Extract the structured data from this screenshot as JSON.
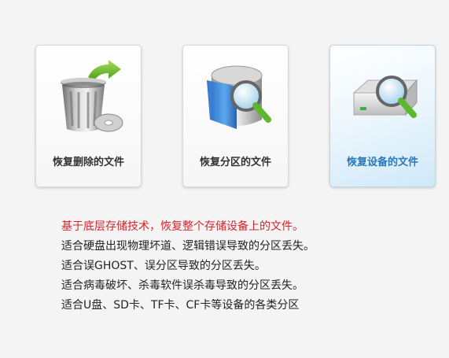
{
  "cards": [
    {
      "label": "恢复删除的文件",
      "icon": "recycle-bin-icon",
      "selected": false
    },
    {
      "label": "恢复分区的文件",
      "icon": "partition-disk-search-icon",
      "selected": false
    },
    {
      "label": "恢复设备的文件",
      "icon": "storage-device-search-icon",
      "selected": true
    }
  ],
  "description": {
    "highlight": "基于底层存储技术，恢复整个存储设备上的文件。",
    "lines": [
      "适合硬盘出现物理坏道、逻辑错误导致的分区丢失。",
      "适合误GHOST、误分区导致的分区丢失。",
      "适合病毒破坏、杀毒软件误杀毒导致的分区丢失。",
      "适合U盘、SD卡、TF卡、CF卡等设备的各类分区"
    ]
  },
  "colors": {
    "highlight_text": "#d9232a",
    "selected_label": "#2a78b8",
    "card_border": "#d9d9d9",
    "selected_card_tint": "#cfe9f8",
    "magnifier_handle": "#5cb82d"
  }
}
